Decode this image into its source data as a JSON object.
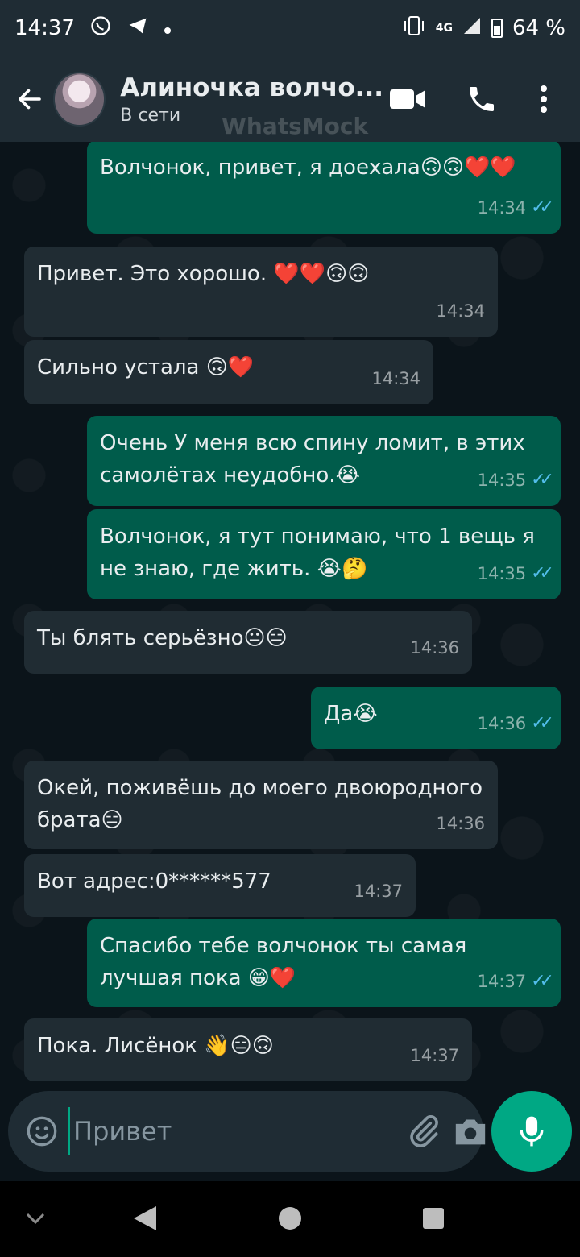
{
  "status_bar": {
    "time": "14:37",
    "network": "4G",
    "battery": "64 %"
  },
  "header": {
    "contact_name": "Алиночка волчо...",
    "contact_status": "В сети",
    "watermark": "WhatsMock"
  },
  "messages": [
    {
      "dir": "out",
      "text": "Волчонок, привет, я доехала🙃🙃❤️❤️",
      "time": "14:34",
      "read": true
    },
    {
      "dir": "in",
      "text": "Привет. Это хорошо. ❤️❤️🙃🙃",
      "time": "14:34"
    },
    {
      "dir": "in",
      "text": "Сильно устала 🙃❤️",
      "time": "14:34"
    },
    {
      "dir": "out",
      "text": "Очень У меня всю спину ломит, в этих самолётах неудобно.😭",
      "time": "14:35",
      "read": true
    },
    {
      "dir": "out",
      "text": "Волчонок, я тут понимаю, что 1 вещь я не знаю, где жить. 😭🤔",
      "time": "14:35",
      "read": true
    },
    {
      "dir": "in",
      "text": "Ты блять серьёзно😐😑",
      "time": "14:36"
    },
    {
      "dir": "out",
      "text": "Да😭",
      "time": "14:36",
      "read": true
    },
    {
      "dir": "in",
      "text": " Окей, поживёшь до моего двоюродного брата😑",
      "time": "14:36"
    },
    {
      "dir": "in",
      "text": "Вот адрес:0******577",
      "time": "14:37"
    },
    {
      "dir": "out",
      "text": "Спасибо тебе волчонок ты самая лучшая пока 😁❤️",
      "time": "14:37",
      "read": true
    },
    {
      "dir": "in",
      "text": "Пока. Лисёнок 👋😑🙃",
      "time": "14:37"
    }
  ],
  "composer": {
    "placeholder": "Привет"
  },
  "colors": {
    "incoming_bubble": "#202c33",
    "outgoing_bubble": "#005c4b",
    "accent": "#00a884",
    "read_ticks": "#53bdeb"
  }
}
